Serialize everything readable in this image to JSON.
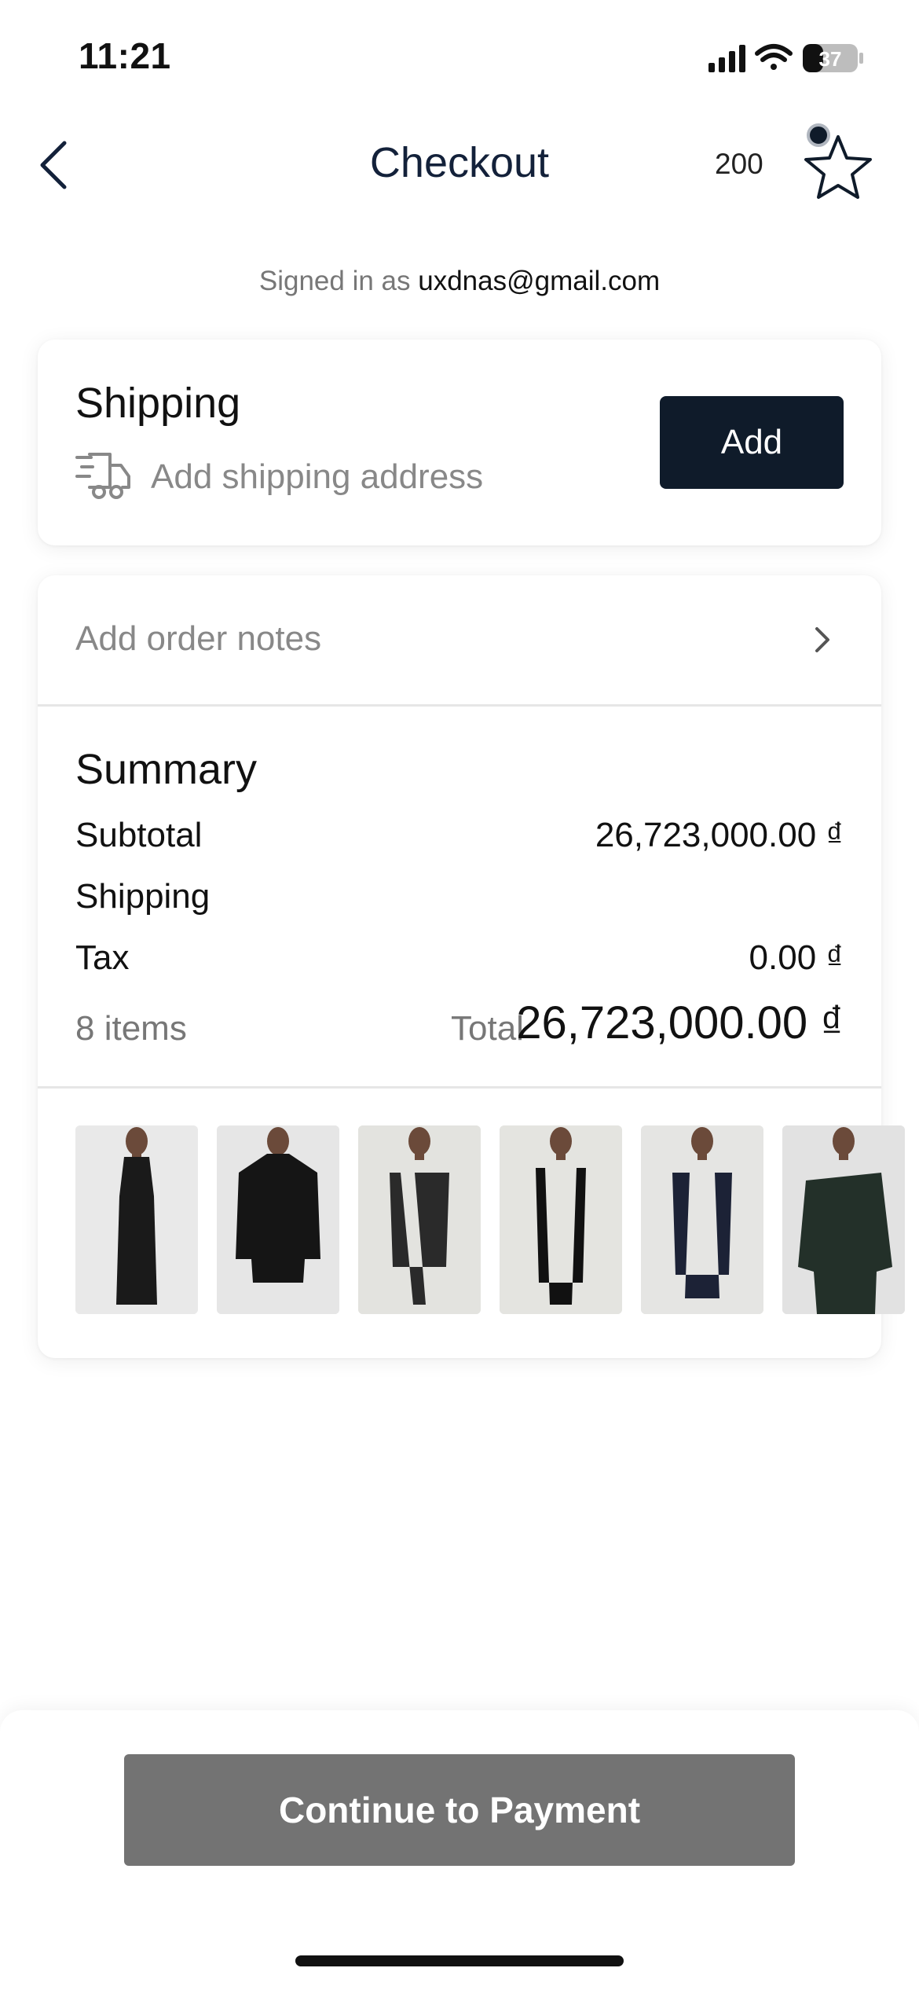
{
  "status_bar": {
    "time": "11:21",
    "battery_level": "37",
    "icons": [
      "cellular-signal-icon",
      "wifi-icon",
      "battery-icon"
    ]
  },
  "header": {
    "title": "Checkout",
    "points": "200",
    "back_icon": "chevron-left-icon",
    "star_icon": "star-icon"
  },
  "account": {
    "label": "Signed in as",
    "email": "uxdnas@gmail.com"
  },
  "shipping": {
    "title": "Shipping",
    "subtitle": "Add shipping address",
    "icon": "delivery-truck-icon",
    "button_label": "Add"
  },
  "order_notes": {
    "label": "Add order notes",
    "icon": "chevron-right-icon"
  },
  "summary": {
    "title": "Summary",
    "subtotal_label": "Subtotal",
    "subtotal_value": "26,723,000.00 ₫",
    "shipping_label": "Shipping",
    "shipping_value": "",
    "tax_label": "Tax",
    "tax_value": "0.00 ₫",
    "items_count": "8 items",
    "total_label": "Total",
    "total_value": "26,723,000.00 ₫"
  },
  "products": [
    {
      "name": "long-black-dress",
      "bg": "#e9e9e9",
      "garment": "#1a1a1a"
    },
    {
      "name": "black-knit-cardigan",
      "bg": "#e6e6e6",
      "garment": "#151515"
    },
    {
      "name": "charcoal-scarf-top",
      "bg": "#e3e3df",
      "garment": "#2a2a2a"
    },
    {
      "name": "black-scarf",
      "bg": "#e4e4e0",
      "garment": "#111111"
    },
    {
      "name": "navy-scarf-top",
      "bg": "#e5e5e3",
      "garment": "#1c2236"
    },
    {
      "name": "dark-green-off-shoulder-top",
      "bg": "#e2e2e2",
      "garment": "#233029"
    }
  ],
  "footer": {
    "button_label": "Continue to Payment"
  },
  "colors": {
    "primary_dark": "#0f1b2a",
    "disabled_button": "#737373",
    "muted_text": "#888888"
  }
}
